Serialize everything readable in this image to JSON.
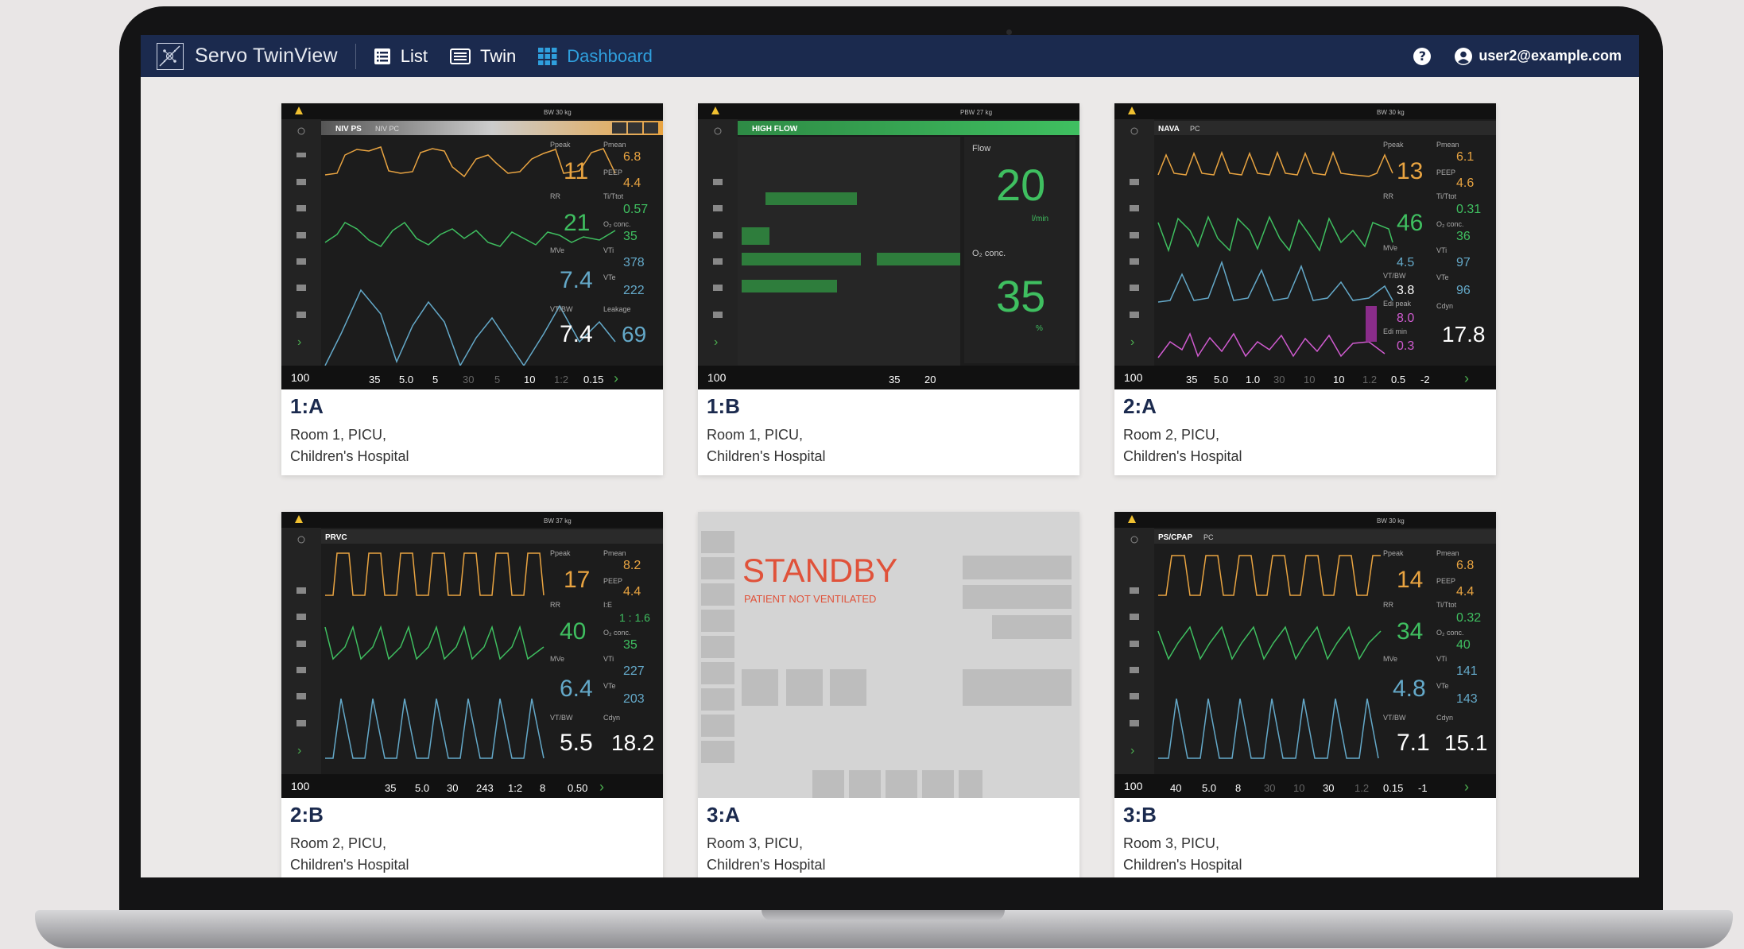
{
  "app": {
    "title": "Servo TwinView"
  },
  "nav": [
    {
      "label": "List",
      "icon": "list-icon"
    },
    {
      "label": "Twin",
      "icon": "twin-icon"
    },
    {
      "label": "Dashboard",
      "icon": "dashboard-grid-icon",
      "active": true
    }
  ],
  "header": {
    "help_icon": "help-icon",
    "user": "user2@example.com"
  },
  "colors": {
    "topbar": "#1b2a4e",
    "active_nav": "#2f9fdd",
    "standby_red": "#e0523a",
    "waveform_yellow": "#e9a441",
    "waveform_green": "#3fbf60",
    "waveform_blue": "#64a9c9",
    "waveform_pink": "#d05bd0"
  },
  "cards": [
    {
      "id": "1:A",
      "location": "Room 1, PICU,\nChildren's Hospital",
      "mode": "NIV PS",
      "mode_secondary": "NIV PC",
      "weight": "BW 30 kg",
      "values": {
        "ppeak": "11",
        "rr": "21",
        "mve": "7.4",
        "vt_bw": "7.4",
        "pmean": "6.8",
        "peep": "4.4",
        "ti_ttot": "0.57",
        "o2": "35",
        "vti": "378",
        "vte": "222",
        "leakage": "69"
      },
      "settings": {
        "o2_conc": "35",
        "peep": "5.0",
        "ps_above_peep": "5",
        "backup_pc": "30",
        "backup_ps": "5",
        "apnea_time": "10",
        "ie": "1:2",
        "trigger": "0.15",
        "o2_boost": "100"
      }
    },
    {
      "id": "1:B",
      "location": "Room 1, PICU,\nChildren's Hospital",
      "mode": "HIGH FLOW",
      "weight": "PBW 27 kg",
      "values": {
        "flow_label": "Flow",
        "flow": "20",
        "flow_unit": "l/min",
        "o2_label": "O₂ conc.",
        "o2": "35",
        "o2_unit": "%"
      },
      "settings": {
        "o2_conc": "35",
        "flow": "20",
        "o2_boost": "100"
      }
    },
    {
      "id": "2:A",
      "location": "Room 2, PICU,\nChildren's Hospital",
      "mode": "NAVA",
      "mode_secondary": "PC",
      "weight": "BW 30 kg",
      "values": {
        "ppeak": "13",
        "rr": "46",
        "mve": "4.5",
        "vt_bw": "3.8",
        "pmean": "6.1",
        "peep": "4.6",
        "ti_ttot": "0.31",
        "o2": "36",
        "vti": "97",
        "vte": "96",
        "edi_peak": "8.0",
        "edi_min": "0.3",
        "cdyn": "17.8"
      },
      "settings": {
        "o2_conc": "35",
        "peep": "5.0",
        "nava_level": "1.0",
        "backup_pc": "30",
        "backup_ps": "10",
        "apnea_time": "10",
        "ie": "1.2",
        "edi_trigger": "0.5",
        "trigger": "-2",
        "o2_boost": "100"
      }
    },
    {
      "id": "2:B",
      "location": "Room 2, PICU,\nChildren's Hospital",
      "mode": "PRVC",
      "weight": "BW 37 kg",
      "values": {
        "ppeak": "17",
        "rr": "40",
        "mve": "6.4",
        "vt_bw": "5.5",
        "pmean": "8.2",
        "peep": "4.4",
        "ie": "1 : 1.6",
        "o2": "35",
        "vti": "227",
        "vte": "203",
        "cdyn": "18.2"
      },
      "settings": {
        "o2_conc": "35",
        "peep": "5.0",
        "rr": "30",
        "tidal_volume": "243",
        "ie": "1:2",
        "trigger": "0.50",
        "temp_rise": "8",
        "o2_boost": "100"
      }
    },
    {
      "id": "3:A",
      "location": "Room 3, PICU,\nChildren's Hospital",
      "standby": true,
      "standby_title": "STANDBY",
      "standby_subtitle": "PATIENT NOT VENTILATED"
    },
    {
      "id": "3:B",
      "location": "Room 3, PICU,\nChildren's Hospital",
      "mode": "PS/CPAP",
      "mode_secondary": "PC",
      "weight": "BW 30 kg",
      "values": {
        "ppeak": "14",
        "rr": "34",
        "mve": "4.8",
        "vt_bw": "7.1",
        "pmean": "6.8",
        "peep": "4.4",
        "ti_ttot": "0.32",
        "o2": "40",
        "vti": "141",
        "vte": "143",
        "cdyn": "15.1"
      },
      "settings": {
        "o2_conc": "40",
        "peep": "5.0",
        "ps_above_peep": "8",
        "backup_pc": "30",
        "backup_ps": "10",
        "apnea_time": "30",
        "ie": "1.2",
        "end_insp": "0.15",
        "trigger": "-1",
        "o2_boost": "100"
      }
    }
  ]
}
